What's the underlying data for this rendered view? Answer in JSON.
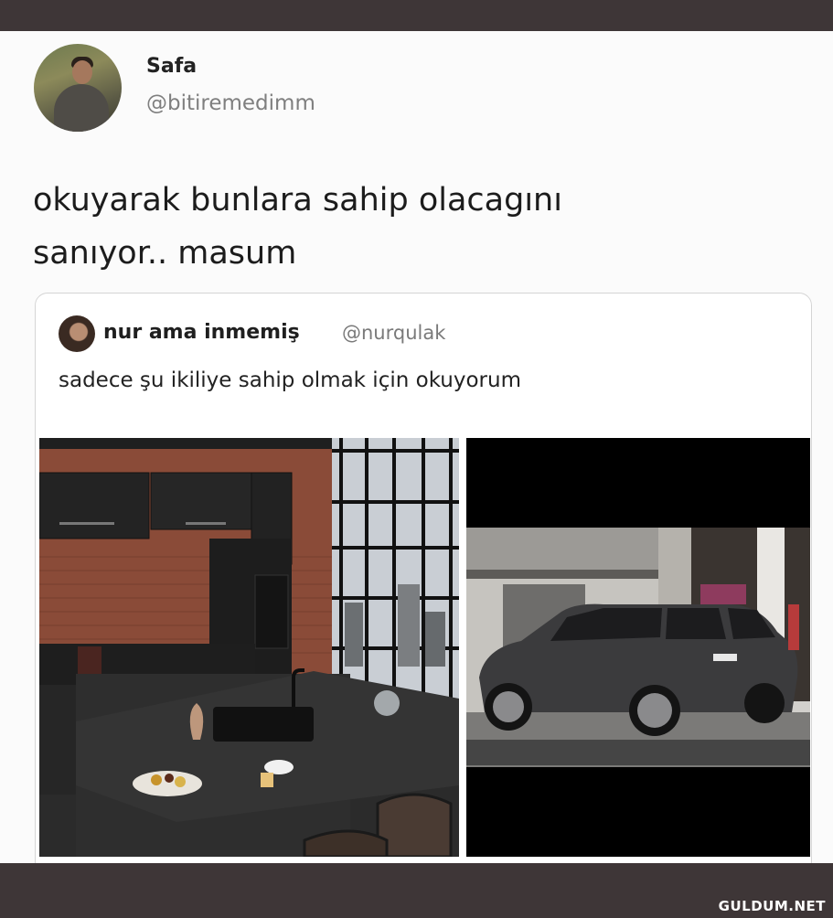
{
  "tweet": {
    "author_name": "Safa",
    "author_handle": "@bitiremedimm",
    "text_line1": "okuyarak bunlara sahip olacagını",
    "text_line2": "sanıyor.. masum"
  },
  "quoted_tweet": {
    "author_name": "nur ama inmemiş",
    "author_handle": "@nurqulak",
    "text": "sadece şu ikiliye sahip olmak için okuyorum"
  },
  "watermark": "GULDUM.NET",
  "colors": {
    "frame": "#3e3637",
    "card": "#fbfbfb",
    "name": "#222222",
    "handle": "#7f7f7f"
  },
  "icons": {
    "author_avatar": "avatar-icon",
    "quoted_avatar": "avatar-icon"
  }
}
